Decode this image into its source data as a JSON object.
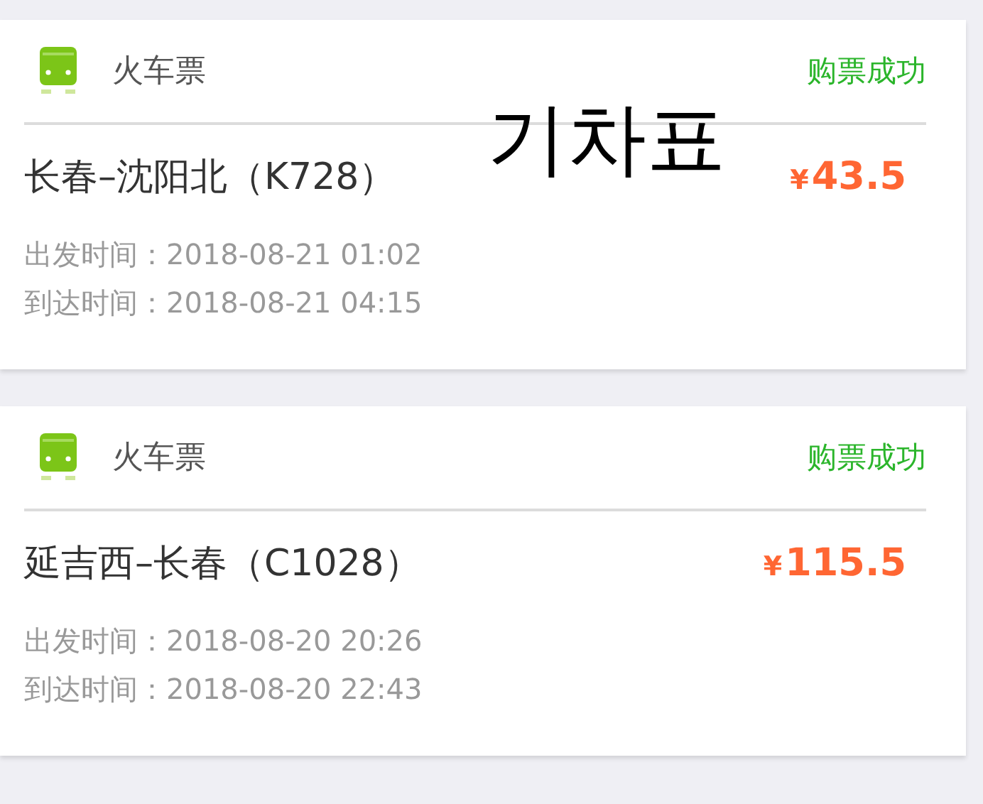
{
  "tickets": [
    {
      "category": "火车票",
      "status": "购票成功",
      "route": "长春–沈阳北（K728）",
      "currency": "¥",
      "amount": "43.5",
      "departure": "出发时间：2018-08-21 01:02",
      "arrival": "到达时间：2018-08-21 04:15"
    },
    {
      "category": "火车票",
      "status": "购票成功",
      "route": "延吉西–长春（C1028）",
      "currency": "¥",
      "amount": "115.5",
      "departure": "出发时间：2018-08-20 20:26",
      "arrival": "到达时间：2018-08-20 22:43"
    }
  ],
  "overlay_caption": "기차표"
}
